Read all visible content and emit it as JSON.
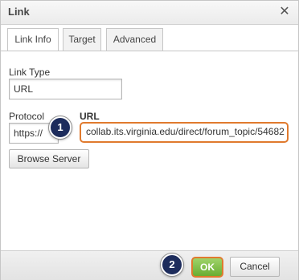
{
  "dialog": {
    "title": "Link",
    "close_glyph": "✕"
  },
  "tabs": [
    {
      "label": "Link Info",
      "active": true
    },
    {
      "label": "Target",
      "active": false
    },
    {
      "label": "Advanced",
      "active": false
    }
  ],
  "link_info": {
    "link_type_label": "Link Type",
    "link_type_value": "URL",
    "protocol_label": "Protocol",
    "protocol_value": "https://",
    "url_label": "URL",
    "url_value": "collab.its.virginia.edu/direct/forum_topic/54682",
    "browse_server_label": "Browse Server"
  },
  "footer": {
    "ok_label": "OK",
    "cancel_label": "Cancel"
  },
  "callouts": [
    {
      "number": "1"
    },
    {
      "number": "2"
    }
  ],
  "colors": {
    "highlight_border": "#e07a2e",
    "callout_fill": "#1d2c5c",
    "ok_green": "#69ad31"
  }
}
